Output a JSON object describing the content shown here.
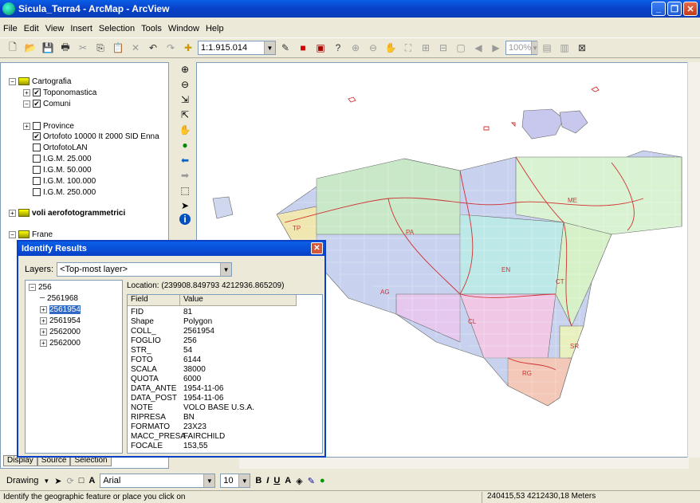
{
  "window": {
    "title": "Sicula_Terra4 - ArcMap - ArcView"
  },
  "menu": [
    "File",
    "Edit",
    "View",
    "Insert",
    "Selection",
    "Tools",
    "Window",
    "Help"
  ],
  "toolbar": {
    "scale": "1:1.915.014",
    "zoom": "100%"
  },
  "toc": {
    "items": [
      {
        "label": "Cartografia",
        "kind": "group",
        "expander": "−"
      },
      {
        "label": "Toponomastica",
        "kind": "layer",
        "checked": "✔",
        "expander": "+"
      },
      {
        "label": "Comuni",
        "kind": "layer",
        "checked": "✔",
        "expander": "−"
      },
      {
        "label": "Province",
        "kind": "layer",
        "checked": "",
        "expander": "+"
      },
      {
        "label": "Ortofoto 10000 It 2000 SID Enna",
        "kind": "layer",
        "checked": "✔",
        "expander": ""
      },
      {
        "label": "OrtofotoLAN",
        "kind": "layer",
        "checked": "",
        "expander": ""
      },
      {
        "label": "I.G.M. 25.000",
        "kind": "layer",
        "checked": "",
        "expander": ""
      },
      {
        "label": "I.G.M. 50.000",
        "kind": "layer",
        "checked": "",
        "expander": ""
      },
      {
        "label": "I.G.M. 100.000",
        "kind": "layer",
        "checked": "",
        "expander": ""
      },
      {
        "label": "I.G.M. 250.000",
        "kind": "layer",
        "checked": "",
        "expander": ""
      },
      {
        "label": "voli aerofotogrammetrici",
        "kind": "group",
        "expander": "+"
      },
      {
        "label": "Frane",
        "kind": "group",
        "expander": "−"
      }
    ],
    "tabs": [
      "Display",
      "Source",
      "Selection"
    ]
  },
  "identify": {
    "title": "Identify Results",
    "layers_label": "Layers:",
    "layers_value": "<Top-most layer>",
    "tree_root": "256",
    "tree_items": [
      "2561968",
      "2561954",
      "2561954",
      "2562000",
      "2562000"
    ],
    "selected_index": 1,
    "location": "Location: (239908.849793 4212936.865209)",
    "headers": [
      "Field",
      "Value"
    ],
    "rows": [
      [
        "FID",
        "81"
      ],
      [
        "Shape",
        "Polygon"
      ],
      [
        "COLL_",
        "2561954"
      ],
      [
        "FOGLIO",
        "256"
      ],
      [
        "STR_",
        "54"
      ],
      [
        "FOTO",
        "6144"
      ],
      [
        "SCALA",
        "38000"
      ],
      [
        "QUOTA",
        "6000"
      ],
      [
        "DATA_ANTE",
        "1954-11-06"
      ],
      [
        "DATA_POST",
        "1954-11-06"
      ],
      [
        "NOTE",
        "VOLO BASE U.S.A."
      ],
      [
        "RIPRESA",
        "BN"
      ],
      [
        "FORMATO",
        "23X23"
      ],
      [
        "MACC_PRESA",
        "FAIRCHILD"
      ],
      [
        "FOCALE",
        "153,55"
      ]
    ]
  },
  "map": {
    "labels": [
      "TP",
      "PA",
      "ME",
      "EN",
      "CT",
      "CL",
      "AG",
      "SR",
      "RG"
    ]
  },
  "drawing": {
    "label": "Drawing",
    "font": "Arial",
    "size": "10"
  },
  "status": {
    "message": "Identify the geographic feature or place you click on",
    "coords": "240415,53  4212430,18 Meters"
  }
}
